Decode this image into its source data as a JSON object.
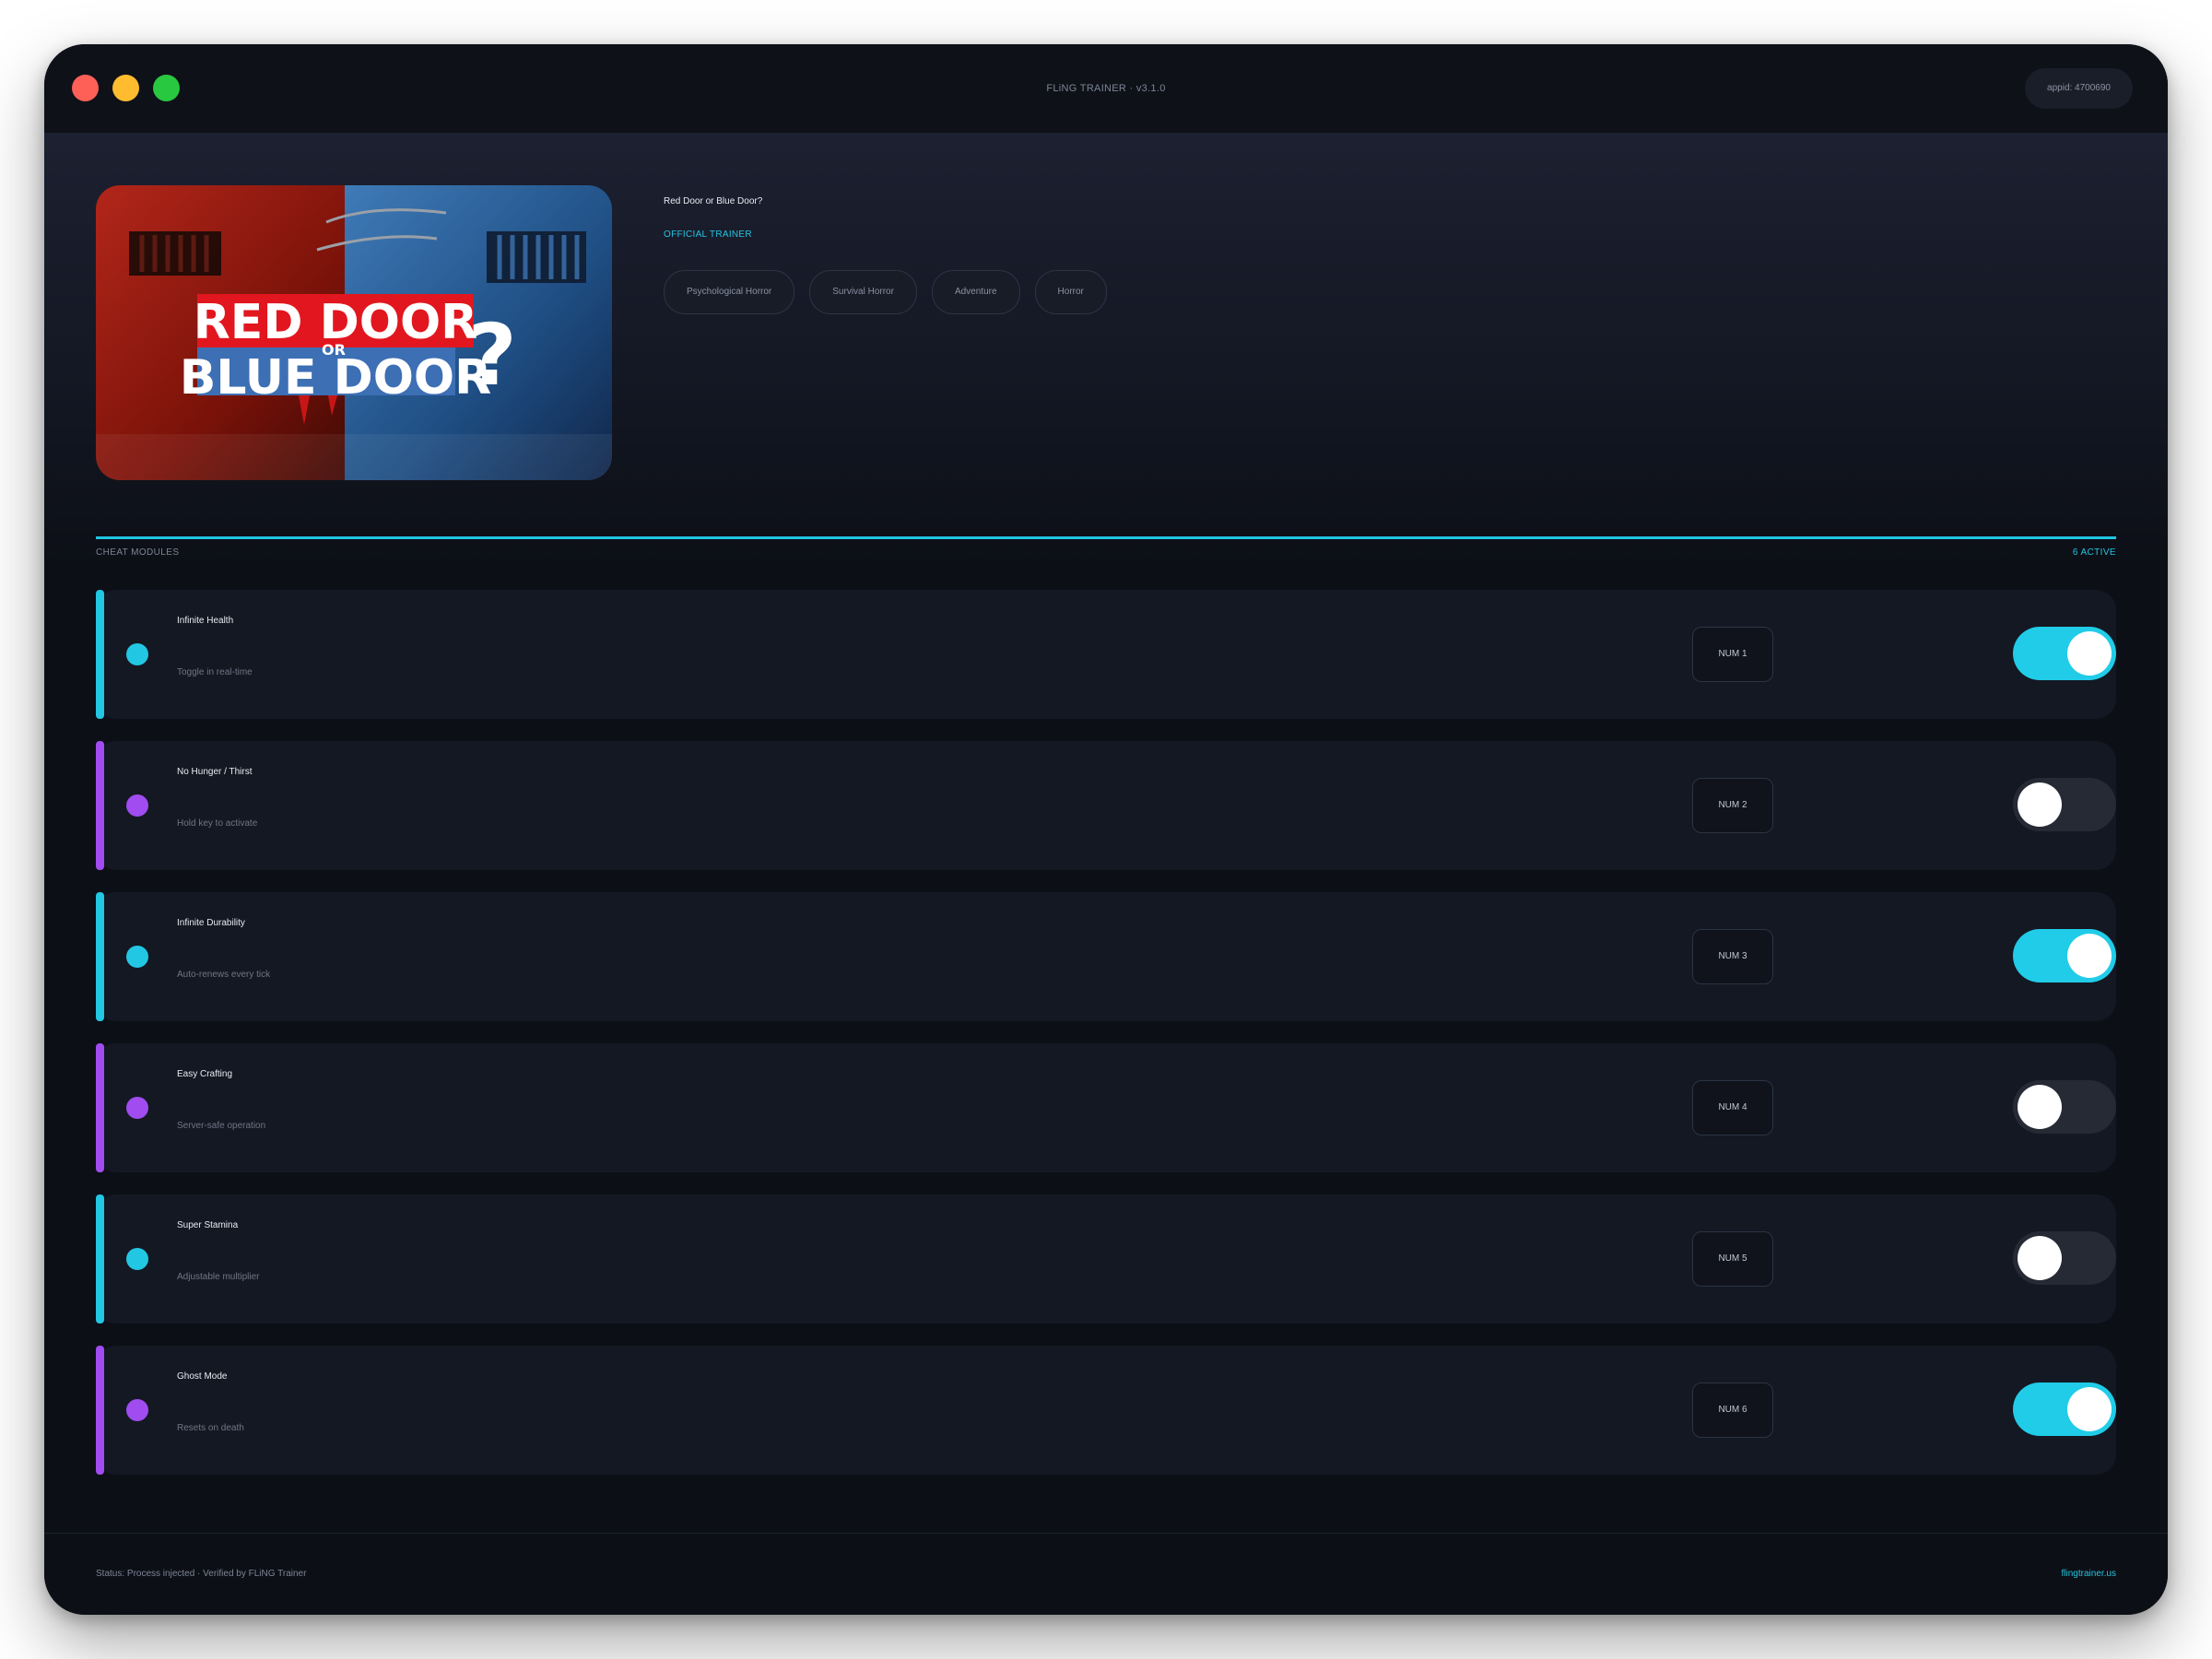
{
  "window": {
    "title": "FLiNG TRAINER · v3.1.0",
    "appid": "appid: 4700690"
  },
  "game": {
    "title": "Red Door or Blue Door?",
    "badge": "OFFICIAL TRAINER",
    "cover_text": {
      "line1": "RED DOOR",
      "or": "OR",
      "line2": "BLUE DOOR",
      "mark": "?"
    },
    "tags": [
      "Psychological Horror",
      "Survival Horror",
      "Adventure",
      "Horror"
    ]
  },
  "modules_header": {
    "label": "CHEAT MODULES",
    "active": "6 ACTIVE"
  },
  "modules": [
    {
      "name": "Infinite Health",
      "desc": "Toggle in real-time",
      "hotkey": "NUM 1",
      "enabled": true,
      "accent": "#22c7e3"
    },
    {
      "name": "No Hunger / Thirst",
      "desc": "Hold key to activate",
      "hotkey": "NUM 2",
      "enabled": false,
      "accent": "#a04cf0"
    },
    {
      "name": "Infinite Durability",
      "desc": "Auto-renews every tick",
      "hotkey": "NUM 3",
      "enabled": true,
      "accent": "#22c7e3"
    },
    {
      "name": "Easy Crafting",
      "desc": "Server-safe operation",
      "hotkey": "NUM 4",
      "enabled": false,
      "accent": "#a04cf0"
    },
    {
      "name": "Super Stamina",
      "desc": "Adjustable multiplier",
      "hotkey": "NUM 5",
      "enabled": false,
      "accent": "#22c7e3"
    },
    {
      "name": "Ghost Mode",
      "desc": "Resets on death",
      "hotkey": "NUM 6",
      "enabled": true,
      "accent": "#a04cf0"
    }
  ],
  "footer": {
    "status": "Status: Process injected · Verified by FLiNG Trainer",
    "link": "flingtrainer.us"
  }
}
